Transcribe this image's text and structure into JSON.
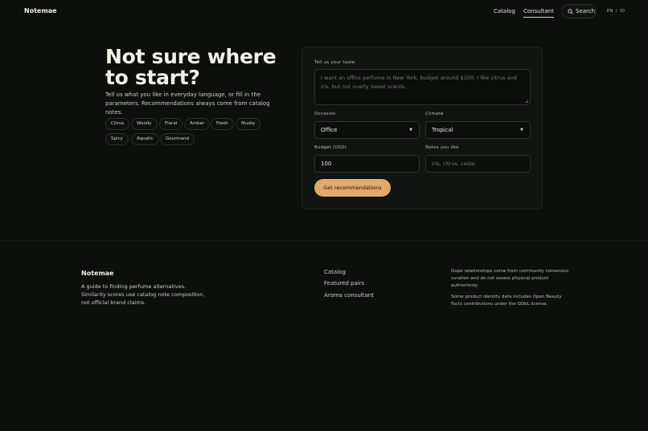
{
  "nav": {
    "brand": "Notemae",
    "links": [
      "Catalog",
      "Consultant"
    ],
    "active": "Consultant",
    "search_label": "Search",
    "lang": {
      "en": "EN",
      "sep": "/",
      "id": "ID"
    }
  },
  "hero": {
    "title": "Not sure where to start?",
    "subtitle": "Tell us what you like in everyday language, or fill in the parameters. Recommendations always come from catalog notes.",
    "chips": [
      "Citrus",
      "Woody",
      "Floral",
      "Amber",
      "Fresh",
      "Musky",
      "Spicy",
      "Aquatic",
      "Gourmand"
    ]
  },
  "form": {
    "taste_label": "Tell us your taste",
    "taste_placeholder": "I want an office perfume in New York, budget around $100. I like citrus and iris, but not overly sweet scents.",
    "occasion_label": "Occasion",
    "occasion_value": "Office",
    "climate_label": "Climate",
    "climate_value": "Tropical",
    "budget_label": "Budget (USD)",
    "budget_value": "100",
    "notes_label": "Notes you like",
    "notes_placeholder": "iris, citrus, cedar",
    "submit_label": "Get recommendations"
  },
  "footer": {
    "brand": "Notemae",
    "description": "A guide to finding perfume alternatives. Similarity scores use catalog note composition, not official brand claims.",
    "links": [
      "Catalog",
      "Featured pairs",
      "Aroma consultant"
    ],
    "notes": [
      "Dupe relationships come from community consensus curation and do not assess physical product authenticity.",
      "Some product identity data includes Open Beauty Facts contributions under the ODbL license."
    ]
  },
  "colors": {
    "background": "#0c0f0c",
    "accent": "#e3a96a",
    "card": "#111411"
  },
  "icons": {
    "search": "search-icon",
    "select": "chevron-down-icon"
  }
}
